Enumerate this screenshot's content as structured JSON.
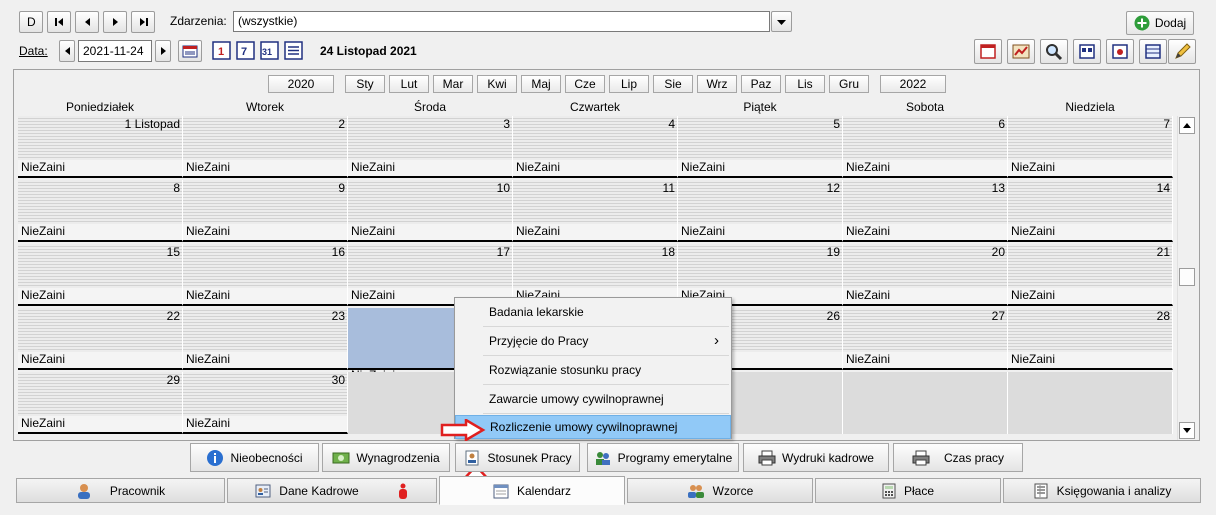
{
  "toolbar": {
    "nav_buttons": [
      "D",
      "|◂",
      "◂",
      "▸",
      "▸|"
    ],
    "events_label": "Zdarzenia:",
    "events_value": "(wszystkie)",
    "add_label": "Dodaj",
    "date_label": "Data:",
    "date_value": "2021-11-24",
    "date_display": "24 Listopad 2021"
  },
  "months_bar": {
    "prev_year": "2020",
    "months": [
      "Sty",
      "Lut",
      "Mar",
      "Kwi",
      "Maj",
      "Cze",
      "Lip",
      "Sie",
      "Wrz",
      "Paz",
      "Lis",
      "Gru"
    ],
    "next_year": "2022"
  },
  "weekdays": [
    "Poniedziałek",
    "Wtorek",
    "Środa",
    "Czwartek",
    "Piątek",
    "Sobota",
    "Niedziela"
  ],
  "weeks": [
    [
      {
        "num": "1 Listopad",
        "ev": "NieZaini"
      },
      {
        "num": "2",
        "ev": "NieZaini"
      },
      {
        "num": "3",
        "ev": "NieZaini"
      },
      {
        "num": "4",
        "ev": "NieZaini"
      },
      {
        "num": "5",
        "ev": "NieZaini"
      },
      {
        "num": "6",
        "ev": "NieZaini"
      },
      {
        "num": "7",
        "ev": "NieZaini"
      }
    ],
    [
      {
        "num": "8",
        "ev": "NieZaini"
      },
      {
        "num": "9",
        "ev": "NieZaini"
      },
      {
        "num": "10",
        "ev": "NieZaini"
      },
      {
        "num": "11",
        "ev": "NieZaini"
      },
      {
        "num": "12",
        "ev": "NieZaini"
      },
      {
        "num": "13",
        "ev": "NieZaini"
      },
      {
        "num": "14",
        "ev": "NieZaini"
      }
    ],
    [
      {
        "num": "15",
        "ev": "NieZaini"
      },
      {
        "num": "16",
        "ev": "NieZaini"
      },
      {
        "num": "17",
        "ev": "NieZaini"
      },
      {
        "num": "18",
        "ev": "NieZaini"
      },
      {
        "num": "19",
        "ev": "NieZaini"
      },
      {
        "num": "20",
        "ev": "NieZaini"
      },
      {
        "num": "21",
        "ev": "NieZaini"
      }
    ],
    [
      {
        "num": "22",
        "ev": "NieZaini"
      },
      {
        "num": "23",
        "ev": "NieZaini"
      },
      {
        "num": "",
        "ev": "NieZaini"
      },
      {
        "num": "",
        "ev": ""
      },
      {
        "num": "26",
        "ev": ""
      },
      {
        "num": "27",
        "ev": "NieZaini"
      },
      {
        "num": "28",
        "ev": "NieZaini"
      }
    ],
    [
      {
        "num": "29",
        "ev": "NieZaini"
      },
      {
        "num": "30",
        "ev": "NieZaini"
      },
      {
        "num": "",
        "ev": ""
      },
      {
        "num": "",
        "ev": ""
      },
      {
        "num": "",
        "ev": ""
      },
      {
        "num": "",
        "ev": ""
      },
      {
        "num": "",
        "ev": ""
      }
    ]
  ],
  "context_menu": {
    "items": [
      "Badania lekarskie",
      "Przyjęcie do Pracy",
      "Rozwiązanie stosunku pracy",
      "Zawarcie umowy cywilnoprawnej",
      "Rozliczenie umowy cywilnoprawnej"
    ],
    "submenu_arrow": "›"
  },
  "subtabs": [
    "Nieobecności",
    "Wynagrodzenia",
    "Stosunek Pracy",
    "Programy emerytalne",
    "Wydruki kadrowe",
    "Czas pracy"
  ],
  "tabs": [
    "Pracownik",
    "Dane Kadrowe",
    "Kalendarz",
    "Wzorce",
    "Płace",
    "Księgowania i analizy"
  ],
  "colors": {
    "accent": "#91c9f7",
    "selected_cell": "#a8bddc",
    "annotation": "#e02020"
  }
}
